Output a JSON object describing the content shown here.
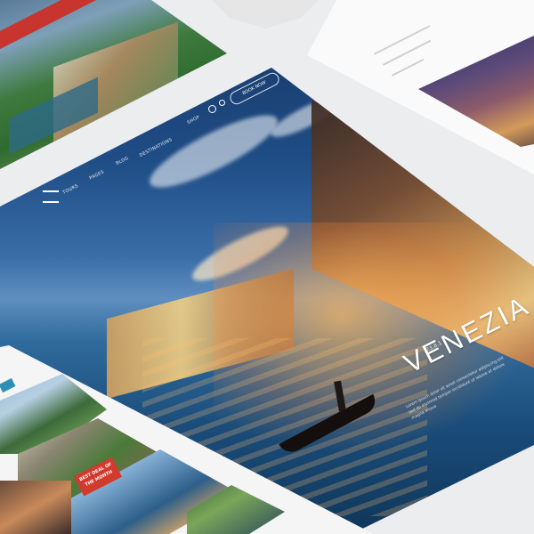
{
  "hero": {
    "title": "VENEZIA",
    "date": "23.8.1",
    "text": "Lorem ipsum dolor sit amet consectetur adipiscing elit sed do eiusmod tempor incididunt ut labore et dolore magna aliqua"
  },
  "nav": {
    "items": [
      "TOURS",
      "PAGES",
      "BLOG",
      "DESTINATIONS",
      "SHOP"
    ],
    "button_label": "BOOK NOW"
  },
  "promo": {
    "badge": "BEST DEAL OF THE MONTH"
  },
  "colors": {
    "accent_red": "#c8352f",
    "badge_red": "#d23a2e",
    "sky_blue": "#1f4d86"
  }
}
